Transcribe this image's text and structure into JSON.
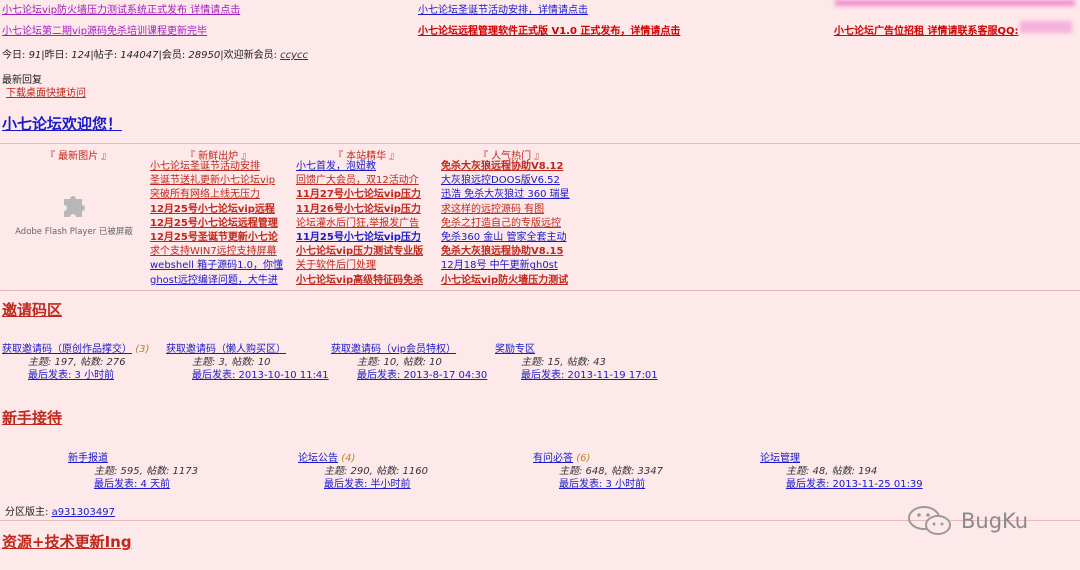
{
  "announcements": {
    "row1_left": "小七论坛vip防火墙压力测试系统正式发布 详情请点击",
    "row1_mid": "小七论坛圣诞节活动安排，详情请点击",
    "row2_left": "小七论坛第二期vip源码免杀培训课程更新完毕",
    "row2_mid": "小七论坛远程管理软件正式版 V1.0 正式发布，详情请点击",
    "row2_right": "小七论坛广告位招租 详情请联系客服QQ:"
  },
  "stats": {
    "today_label": "今日: ",
    "today": "91",
    "yesterday_label": "昨日: ",
    "yesterday": "124",
    "posts_label": "帖子: ",
    "posts": "144047",
    "members_label": "会员: ",
    "members": "28950",
    "welcome_label": "欢迎新会员: ",
    "new_member": "ccycc"
  },
  "latest_reply": "最新回复",
  "download_shortcut": "下载桌面快捷访问",
  "welcome_title": "小七论坛欢迎您！",
  "column_heads": {
    "pictures": "『 最新图片 』",
    "fresh": "『 新鲜出炉 』",
    "essence": "『 本站精华 』",
    "popular": "『 人气热门 』"
  },
  "flash_placeholder": "Adobe Flash Player 已被屏蔽",
  "fresh_items": [
    "小七论坛圣诞节活动安排",
    "圣诞节送礼更新小七论坛vip",
    "突破所有网络上线无压力",
    "12月25号小七论坛vip远程",
    "12月25号小七论坛远程管理",
    "12月25号圣诞节更新小七论",
    "求个支持WIN7远控支持屏幕",
    "webshell 箱子源码1.0，你懂",
    "ghost远控编译问题，大牛进"
  ],
  "essence_items": [
    "小七首发，泡妞教",
    "回馈广大会员，双12活动介",
    "11月27号小七论坛vip压力",
    "11月26号小七论坛vip压力",
    "论坛灌水后门狂,举报发广告",
    "11月25号小七论坛vip压力",
    "小七论坛vip压力测试专业版",
    "关于软件后门处理",
    "小七论坛vip高级特征码免杀"
  ],
  "popular_items": [
    "免杀大灰狼远程协助V8.12",
    "大灰狼远控DOOS版V6.52",
    "迅浩 免杀大灰狼过 360 瑞星",
    "求这样的远控源码 有图",
    "免杀之打造自己的专版远控",
    "免杀360 金山 管家全套主动",
    "免杀大灰狼远程协助V8.15",
    "12月18号 中午更新gh0st",
    "小七论坛vip防火墙压力测试"
  ],
  "section_invite": {
    "title": "邀请码区",
    "forums": [
      {
        "name": "获取邀请码（原创作品撑交）",
        "count": "(3)",
        "meta": "主题: 197, 帖数: 276",
        "last": "最后发表: 3 小时前"
      },
      {
        "name": "获取邀请码（懒人购买区）",
        "count": "",
        "meta": "主题: 3, 帖数: 10",
        "last": "最后发表: 2013-10-10 11:41"
      },
      {
        "name": "获取邀请码（vip会员特权）",
        "count": "",
        "meta": "主题: 10, 帖数: 10",
        "last": "最后发表: 2013-8-17 04:30"
      },
      {
        "name": "奖励专区",
        "count": "",
        "meta": "主题: 15, 帖数: 43",
        "last": "最后发表: 2013-11-19 17:01"
      }
    ]
  },
  "section_newbie": {
    "title": "新手接待",
    "forums": [
      {
        "name": "新手报道",
        "count": "",
        "meta": "主题: 595, 帖数: 1173",
        "last": "最后发表: 4 天前"
      },
      {
        "name": "论坛公告",
        "count": "(4)",
        "meta": "主题: 290, 帖数: 1160",
        "last": "最后发表: 半小时前"
      },
      {
        "name": "有问必答",
        "count": "(6)",
        "meta": "主题: 648, 帖数: 3347",
        "last": "最后发表: 3 小时前"
      },
      {
        "name": "论坛管理",
        "count": "",
        "meta": "主题: 48, 帖数: 194",
        "last": "最后发表: 2013-11-25 01:39"
      }
    ],
    "moderator_label": "分区版主: ",
    "moderator": "a931303497"
  },
  "section_resources": {
    "title": "资源+技术更新Ing"
  },
  "watermark": "BugKu",
  "colors": {
    "bg": "#fde8ea",
    "red": "#c0281c",
    "blue": "#1a1acc"
  }
}
